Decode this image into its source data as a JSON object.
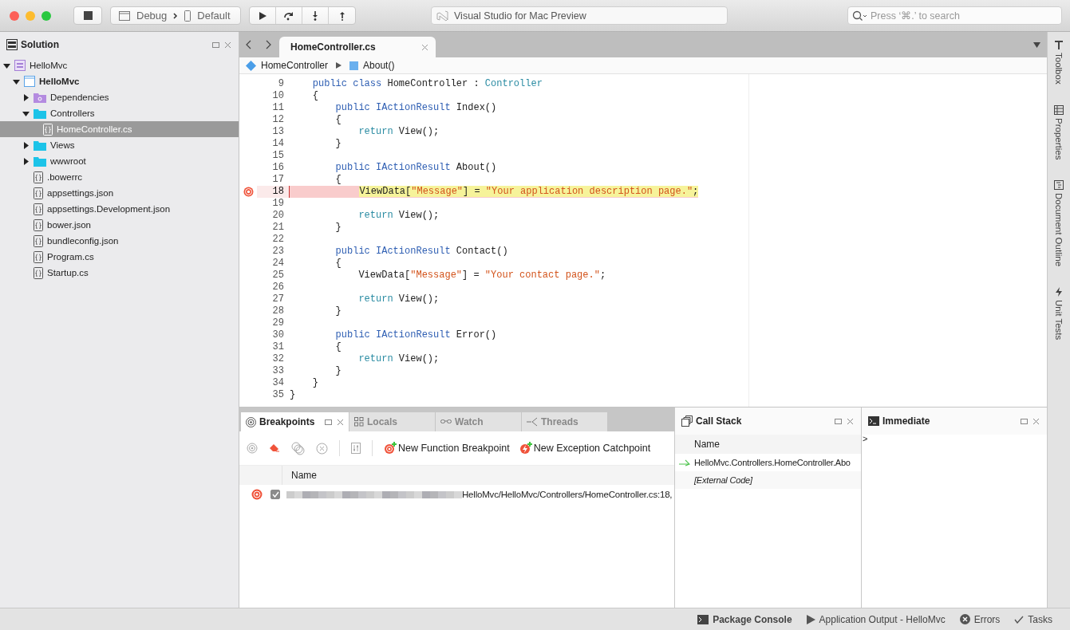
{
  "toolbar": {
    "configuration": "Debug",
    "device": "Default",
    "status": "Visual Studio for Mac Preview",
    "search": {
      "placeholder": "Press ‘⌘.’ to search"
    }
  },
  "solution_pad": {
    "title": "Solution",
    "tree": [
      {
        "label": "HelloMvc",
        "kind": "solution",
        "expanded": true,
        "selected": false,
        "children": [
          {
            "label": "HelloMvc",
            "kind": "project",
            "expanded": true,
            "selected": false,
            "children": [
              {
                "label": "Dependencies",
                "kind": "dependencies",
                "expanded": false,
                "selected": false
              },
              {
                "label": "Controllers",
                "kind": "folder",
                "expanded": true,
                "selected": false,
                "children": [
                  {
                    "label": "HomeController.cs",
                    "kind": "file",
                    "selected": true
                  }
                ]
              },
              {
                "label": "Views",
                "kind": "folder",
                "expanded": false,
                "selected": false
              },
              {
                "label": "wwwroot",
                "kind": "folder",
                "expanded": false,
                "selected": false
              },
              {
                "label": ".bowerrc",
                "kind": "file",
                "selected": false
              },
              {
                "label": "appsettings.json",
                "kind": "file",
                "selected": false
              },
              {
                "label": "appsettings.Development.json",
                "kind": "file",
                "selected": false
              },
              {
                "label": "bower.json",
                "kind": "file",
                "selected": false
              },
              {
                "label": "bundleconfig.json",
                "kind": "file",
                "selected": false
              },
              {
                "label": "Program.cs",
                "kind": "file",
                "selected": false
              },
              {
                "label": "Startup.cs",
                "kind": "file",
                "selected": false
              }
            ]
          }
        ]
      }
    ]
  },
  "editor": {
    "tabs": [
      {
        "label": "HomeController.cs",
        "selected": true
      }
    ],
    "breadcrumb": [
      {
        "label": "HomeController",
        "kind": "class"
      },
      {
        "label": "About()",
        "kind": "method"
      }
    ],
    "lines": [
      {
        "number": "9",
        "breakpoint": false,
        "current": false,
        "tokens": [
          {
            "text": "    public class",
            "kind": "keyword"
          },
          {
            "text": " HomeController : ",
            "kind": "plain"
          },
          {
            "text": "Controller",
            "kind": "type"
          }
        ]
      },
      {
        "number": "10",
        "breakpoint": false,
        "current": false,
        "tokens": [
          {
            "text": "    {",
            "kind": "plain"
          }
        ]
      },
      {
        "number": "11",
        "breakpoint": false,
        "current": false,
        "tokens": [
          {
            "text": "        public IActionResult",
            "kind": "keyword"
          },
          {
            "text": " Index()",
            "kind": "plain"
          }
        ]
      },
      {
        "number": "12",
        "breakpoint": false,
        "current": false,
        "tokens": [
          {
            "text": "        {",
            "kind": "plain"
          }
        ]
      },
      {
        "number": "13",
        "breakpoint": false,
        "current": false,
        "tokens": [
          {
            "text": "            return",
            "kind": "control"
          },
          {
            "text": " View();",
            "kind": "plain"
          }
        ]
      },
      {
        "number": "14",
        "breakpoint": false,
        "current": false,
        "tokens": [
          {
            "text": "        }",
            "kind": "plain"
          }
        ]
      },
      {
        "number": "15",
        "breakpoint": false,
        "current": false
      },
      {
        "number": "16",
        "breakpoint": false,
        "current": false,
        "tokens": [
          {
            "text": "        public IActionResult",
            "kind": "keyword"
          },
          {
            "text": " About()",
            "kind": "plain"
          }
        ]
      },
      {
        "number": "17",
        "breakpoint": false,
        "current": false,
        "tokens": [
          {
            "text": "        {",
            "kind": "plain"
          }
        ]
      },
      {
        "number": "18",
        "breakpoint": true,
        "current": true,
        "tokens": [
          {
            "text": "            ViewData[",
            "kind": "plain"
          },
          {
            "text": "\"Message\"",
            "kind": "string"
          },
          {
            "text": "] = ",
            "kind": "plain"
          },
          {
            "text": "\"Your application description page.\"",
            "kind": "string"
          },
          {
            "text": ";",
            "kind": "plain"
          }
        ]
      },
      {
        "number": "19",
        "breakpoint": false,
        "current": false
      },
      {
        "number": "20",
        "breakpoint": false,
        "current": false,
        "tokens": [
          {
            "text": "            return",
            "kind": "control"
          },
          {
            "text": " View();",
            "kind": "plain"
          }
        ]
      },
      {
        "number": "21",
        "breakpoint": false,
        "current": false,
        "tokens": [
          {
            "text": "        }",
            "kind": "plain"
          }
        ]
      },
      {
        "number": "22",
        "breakpoint": false,
        "current": false
      },
      {
        "number": "23",
        "breakpoint": false,
        "current": false,
        "tokens": [
          {
            "text": "        public IActionResult",
            "kind": "keyword"
          },
          {
            "text": " Contact()",
            "kind": "plain"
          }
        ]
      },
      {
        "number": "24",
        "breakpoint": false,
        "current": false,
        "tokens": [
          {
            "text": "        {",
            "kind": "plain"
          }
        ]
      },
      {
        "number": "25",
        "breakpoint": false,
        "current": false,
        "tokens": [
          {
            "text": "            ViewData[",
            "kind": "plain"
          },
          {
            "text": "\"Message\"",
            "kind": "string"
          },
          {
            "text": "] = ",
            "kind": "plain"
          },
          {
            "text": "\"Your contact page.\"",
            "kind": "string"
          },
          {
            "text": ";",
            "kind": "plain"
          }
        ]
      },
      {
        "number": "26",
        "breakpoint": false,
        "current": false
      },
      {
        "number": "27",
        "breakpoint": false,
        "current": false,
        "tokens": [
          {
            "text": "            return",
            "kind": "control"
          },
          {
            "text": " View();",
            "kind": "plain"
          }
        ]
      },
      {
        "number": "28",
        "breakpoint": false,
        "current": false,
        "tokens": [
          {
            "text": "        }",
            "kind": "plain"
          }
        ]
      },
      {
        "number": "29",
        "breakpoint": false,
        "current": false
      },
      {
        "number": "30",
        "breakpoint": false,
        "current": false,
        "tokens": [
          {
            "text": "        public IActionResult",
            "kind": "keyword"
          },
          {
            "text": " Error()",
            "kind": "plain"
          }
        ]
      },
      {
        "number": "31",
        "breakpoint": false,
        "current": false,
        "tokens": [
          {
            "text": "        {",
            "kind": "plain"
          }
        ]
      },
      {
        "number": "32",
        "breakpoint": false,
        "current": false,
        "tokens": [
          {
            "text": "            return",
            "kind": "control"
          },
          {
            "text": " View();",
            "kind": "plain"
          }
        ]
      },
      {
        "number": "33",
        "breakpoint": false,
        "current": false,
        "tokens": [
          {
            "text": "        }",
            "kind": "plain"
          }
        ]
      },
      {
        "number": "34",
        "breakpoint": false,
        "current": false,
        "tokens": [
          {
            "text": "    }",
            "kind": "plain"
          }
        ]
      },
      {
        "number": "35",
        "breakpoint": false,
        "current": false,
        "tokens": [
          {
            "text": "}",
            "kind": "plain"
          }
        ]
      }
    ]
  },
  "breakpoints_pad": {
    "tabs": [
      {
        "label": "Breakpoints",
        "kind": "breakpoints",
        "selected": true
      },
      {
        "label": "Locals",
        "kind": "locals",
        "selected": false
      },
      {
        "label": "Watch",
        "kind": "watch",
        "selected": false
      },
      {
        "label": "Threads",
        "kind": "threads",
        "selected": false
      }
    ],
    "actions": [
      {
        "label": "New Function Breakpoint",
        "kind": "function"
      },
      {
        "label": "New Exception Catchpoint",
        "kind": "exception"
      }
    ],
    "column": "Name",
    "rows": [
      {
        "enabled": true,
        "location": "HelloMvc/HelloMvc/Controllers/HomeController.cs:18,"
      }
    ]
  },
  "call_stack": {
    "title": "Call Stack",
    "column": "Name",
    "frames": [
      {
        "name": "HelloMvc.Controllers.HomeController.Abo",
        "current": true,
        "external": false
      },
      {
        "name": "[External Code]",
        "current": false,
        "external": true
      }
    ]
  },
  "immediate": {
    "title": "Immediate",
    "prompt": ">"
  },
  "side_tabs": [
    {
      "label": "Toolbox",
      "kind": "toolbox"
    },
    {
      "label": "Properties",
      "kind": "properties"
    },
    {
      "label": "Document Outline",
      "kind": "outline"
    },
    {
      "label": "Unit Tests",
      "kind": "tests"
    }
  ],
  "status_bar": [
    {
      "label": "Package Console",
      "kind": "console",
      "selected": true
    },
    {
      "label": "Application Output - HelloMvc",
      "kind": "output",
      "selected": false
    },
    {
      "label": "Errors",
      "kind": "errors",
      "selected": false
    },
    {
      "label": "Tasks",
      "kind": "tasks",
      "selected": false
    }
  ]
}
